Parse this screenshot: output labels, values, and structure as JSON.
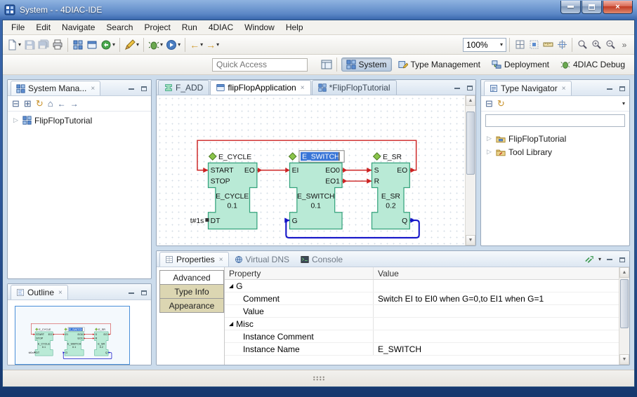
{
  "colors": {
    "titlebar_blue": "#3a67ad",
    "selection_blue": "#3875d7",
    "fb_fill": "#b9ead6",
    "fb_border": "#35a27c",
    "event_connection_red": "#cc2222",
    "data_connection_blue": "#1414c8",
    "panel_header": "#dde7f2",
    "frame_bottom_blue": "#16386e",
    "side_tab_khaki": "#dcd6b2"
  },
  "icons": {
    "dropdown": "▾",
    "close": "×",
    "collapse_all": "⊟",
    "expand_all": "⊞",
    "refresh": "↻",
    "home": "⌂",
    "back": "←",
    "forward": "→",
    "tree_collapsed": "▷",
    "group_expanded": "◢",
    "scroll_up": "▲",
    "scroll_down": "▼",
    "overflow": "»"
  },
  "window": {
    "title": "System -  - 4DIAC-IDE"
  },
  "menubar": [
    "File",
    "Edit",
    "Navigate",
    "Search",
    "Project",
    "Run",
    "4DIAC",
    "Window",
    "Help"
  ],
  "toolbar": {
    "zoom_value": "100%",
    "quick_access_placeholder": "Quick Access"
  },
  "perspectives": [
    {
      "label": "System"
    },
    {
      "label": "Type Management"
    },
    {
      "label": "Deployment"
    },
    {
      "label": "4DIAC Debug"
    }
  ],
  "system_manager": {
    "title": "System Mana...",
    "tree": [
      {
        "label": "FlipFlopTutorial"
      }
    ]
  },
  "outline": {
    "title": "Outline"
  },
  "editor": {
    "tabs": [
      {
        "label": "F_ADD"
      },
      {
        "label": "flipFlopApplication"
      },
      {
        "label": "*FlipFlopTutorial"
      }
    ]
  },
  "diagram": {
    "e_cycle": {
      "title": "E_CYCLE",
      "type_name": "E_CYCLE",
      "version": "0.1",
      "event_inputs": [
        "START",
        "STOP"
      ],
      "event_outputs": [
        "EO"
      ],
      "data_inputs": [
        "DT"
      ],
      "dt_value": "t#1s"
    },
    "e_switch": {
      "title": "E_SWITCH",
      "type_name": "E_SWITCH",
      "version": "0.1",
      "event_inputs": [
        "EI"
      ],
      "event_outputs": [
        "EO0",
        "EO1"
      ],
      "data_inputs": [
        "G"
      ]
    },
    "e_sr": {
      "title": "E_SR",
      "type_name": "E_SR",
      "version": "0.2",
      "event_inputs": [
        "S",
        "R"
      ],
      "event_outputs": [
        "EO"
      ],
      "data_outputs": [
        "Q"
      ]
    }
  },
  "type_navigator": {
    "title": "Type Navigator",
    "filter_value": "",
    "tree": [
      {
        "label": "FlipFlopTutorial"
      },
      {
        "label": "Tool Library"
      }
    ]
  },
  "properties": {
    "tabs": [
      {
        "label": "Properties"
      },
      {
        "label": "Virtual DNS"
      },
      {
        "label": "Console"
      }
    ],
    "side_tabs": [
      {
        "label": "Advanced"
      },
      {
        "label": "Type Info"
      },
      {
        "label": "Appearance"
      }
    ],
    "columns": {
      "property": "Property",
      "value": "Value"
    },
    "rows": [
      {
        "property": "G",
        "value": "",
        "group": true
      },
      {
        "property": "Comment",
        "value": "Switch EI to EI0 when G=0,to EI1 when G=1"
      },
      {
        "property": "Value",
        "value": ""
      },
      {
        "property": "Misc",
        "value": "",
        "group": true
      },
      {
        "property": "Instance Comment",
        "value": ""
      },
      {
        "property": "Instance Name",
        "value": "E_SWITCH"
      }
    ]
  }
}
